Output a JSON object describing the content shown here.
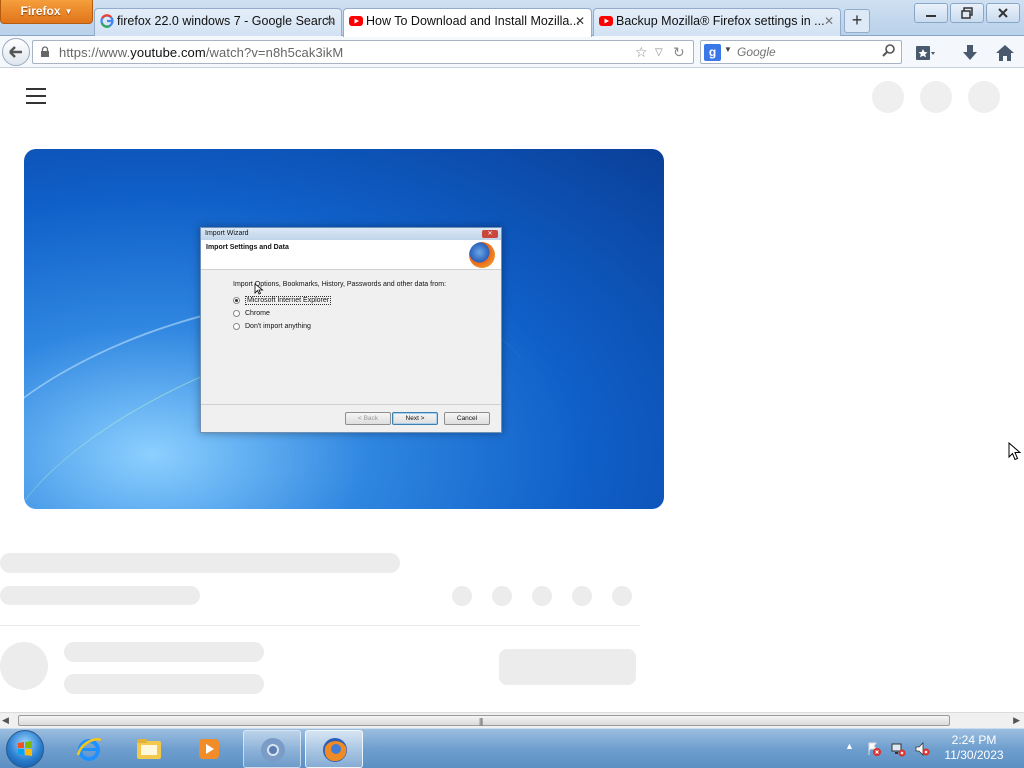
{
  "browser": {
    "menu_button": "Firefox",
    "tabs": [
      {
        "title": "firefox 22.0 windows 7 - Google Search",
        "favicon": "google-icon",
        "active": false
      },
      {
        "title": "How To Download and Install Mozilla...",
        "favicon": "youtube-icon",
        "active": true
      },
      {
        "title": "Backup Mozilla® Firefox settings in ...",
        "favicon": "youtube-icon",
        "active": false
      }
    ],
    "new_tab_label": "+",
    "url": {
      "prefix": "https://www.",
      "domain": "youtube.com",
      "path": "/watch?v=n8h5cak3ikM"
    },
    "search": {
      "engine_letter": "g",
      "placeholder": "Google"
    }
  },
  "video": {
    "wizard": {
      "title": "Import Wizard",
      "header": "Import Settings and Data",
      "prompt": "Import Options, Bookmarks, History, Passwords and other data from:",
      "options": [
        {
          "label": "Microsoft Internet Explorer",
          "selected": true
        },
        {
          "label": "Chrome",
          "selected": false
        },
        {
          "label": "Don't import anything",
          "selected": false
        }
      ],
      "buttons": {
        "back": "< Back",
        "next": "Next >",
        "cancel": "Cancel"
      }
    }
  },
  "taskbar": {
    "apps": [
      "internet-explorer-icon",
      "windows-explorer-icon",
      "media-player-icon",
      "chrome-icon",
      "firefox-icon"
    ],
    "clock": {
      "time": "2:24 PM",
      "date": "11/30/2023"
    }
  },
  "colors": {
    "firefox_orange": "#e1741a",
    "youtube_red": "#ff0000",
    "win7_blue": "#0f5fc8",
    "skeleton_gray": "#ececec"
  }
}
